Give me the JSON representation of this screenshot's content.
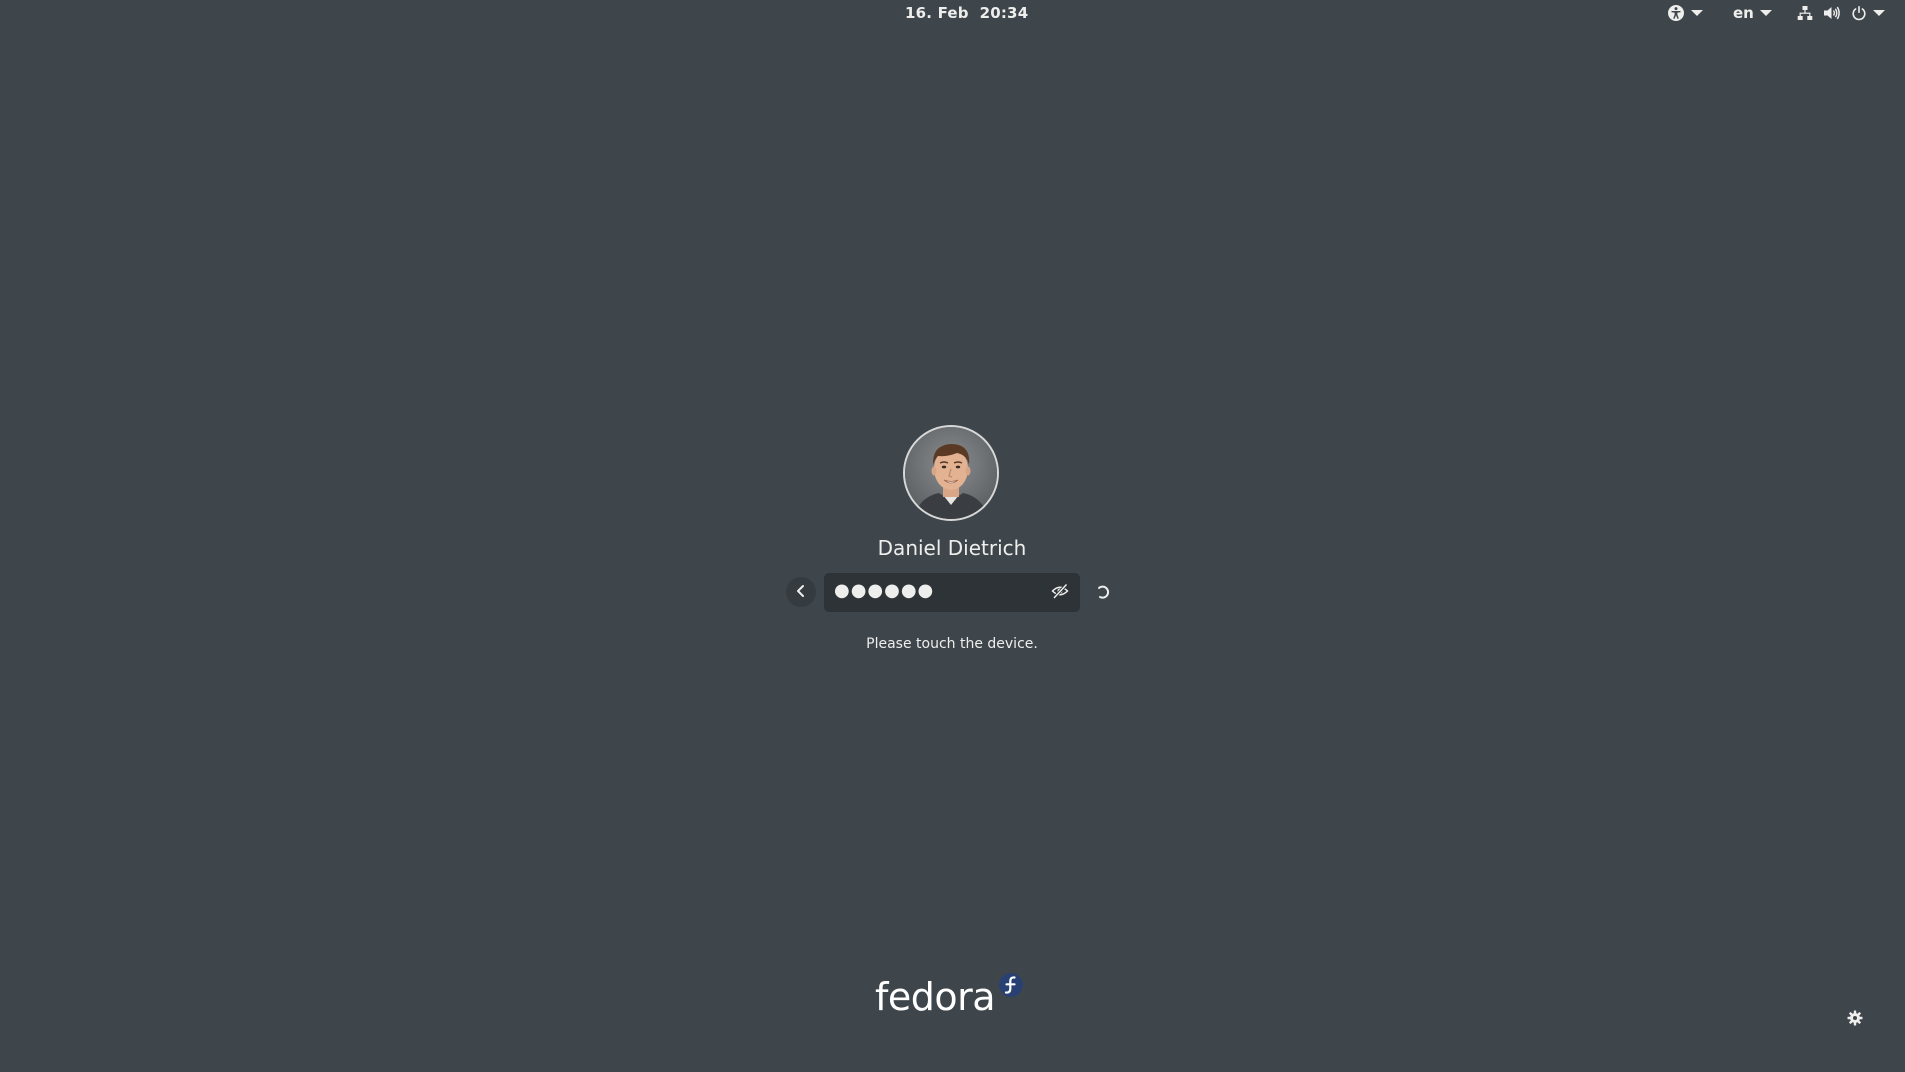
{
  "top_bar": {
    "clock": "16. Feb  20:34",
    "accessibility_icon": "accessibility-icon",
    "language": "en",
    "network_icon": "wired-network-icon",
    "volume_icon": "volume-icon",
    "power_icon": "power-icon"
  },
  "login": {
    "user_name": "Daniel Dietrich",
    "password_masked": "●●●●●●",
    "prompt": "Please touch the device.",
    "back_icon": "chevron-left-icon",
    "reveal_icon": "eye-slash-icon",
    "spinner_icon": "spinner-icon"
  },
  "branding": {
    "logo_text": "fedora",
    "badge_color": "#294172"
  },
  "settings_icon": "gear-icon",
  "colors": {
    "background": "#3f464b",
    "entry_bg": "#2e3337",
    "text": "#eeeeec"
  }
}
